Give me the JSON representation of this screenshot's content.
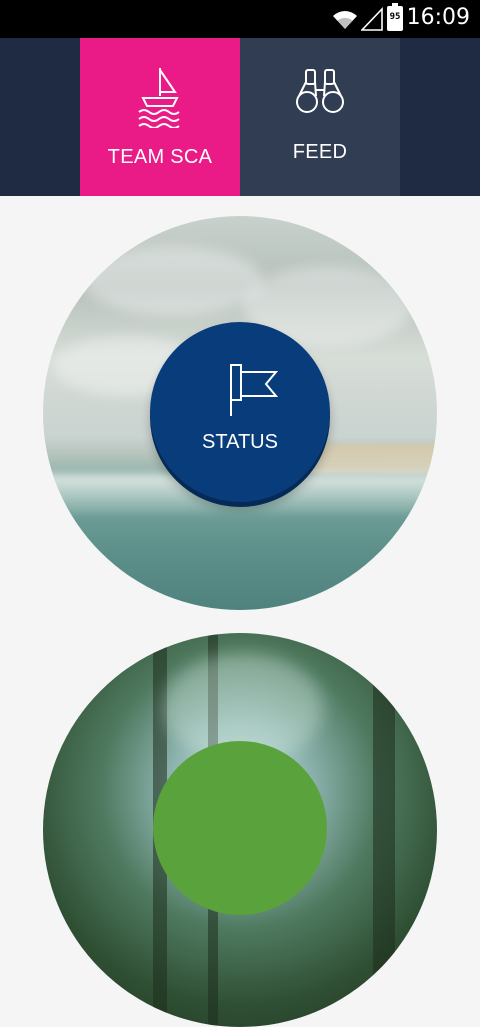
{
  "status_bar": {
    "time": "16:09",
    "battery_level": "95",
    "icons": [
      "wifi-icon",
      "signal-icon",
      "battery-icon"
    ]
  },
  "tabs": [
    {
      "label": "TEAM SCA",
      "icon": "sailboat-icon",
      "active": true,
      "color": "#ea1b87"
    },
    {
      "label": "FEED",
      "icon": "binoculars-icon",
      "active": false,
      "color": "#303d52"
    }
  ],
  "tabbar_color": "#1e2b42",
  "main": {
    "status_button": {
      "label": "STATUS",
      "icon": "flag-icon",
      "color": "#083c7a"
    },
    "second_button": {
      "color": "#5aa33c"
    },
    "images": [
      "ocean-beach-photo",
      "forest-photo"
    ]
  }
}
